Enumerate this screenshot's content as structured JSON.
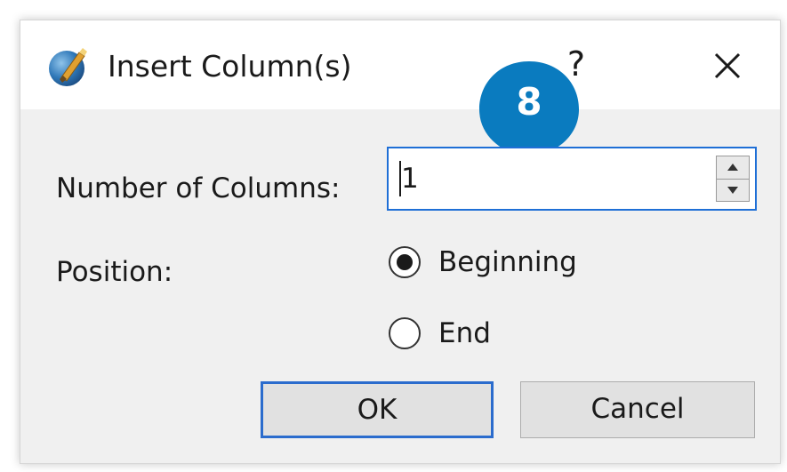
{
  "dialog": {
    "title": "Insert Column(s)",
    "help_label": "?",
    "close_icon": "close-icon",
    "app_icon": "paint-brush-icon"
  },
  "callout": {
    "number": "8",
    "color": "#0a7bbf"
  },
  "form": {
    "columns_label": "Number of Columns:",
    "columns_value": "1",
    "position_label": "Position:",
    "position_options": [
      {
        "label": "Beginning",
        "selected": true
      },
      {
        "label": "End",
        "selected": false
      }
    ]
  },
  "buttons": {
    "ok": "OK",
    "cancel": "Cancel"
  },
  "colors": {
    "focus_border": "#1f6fd6",
    "dialog_bg": "#f0f0f0"
  }
}
